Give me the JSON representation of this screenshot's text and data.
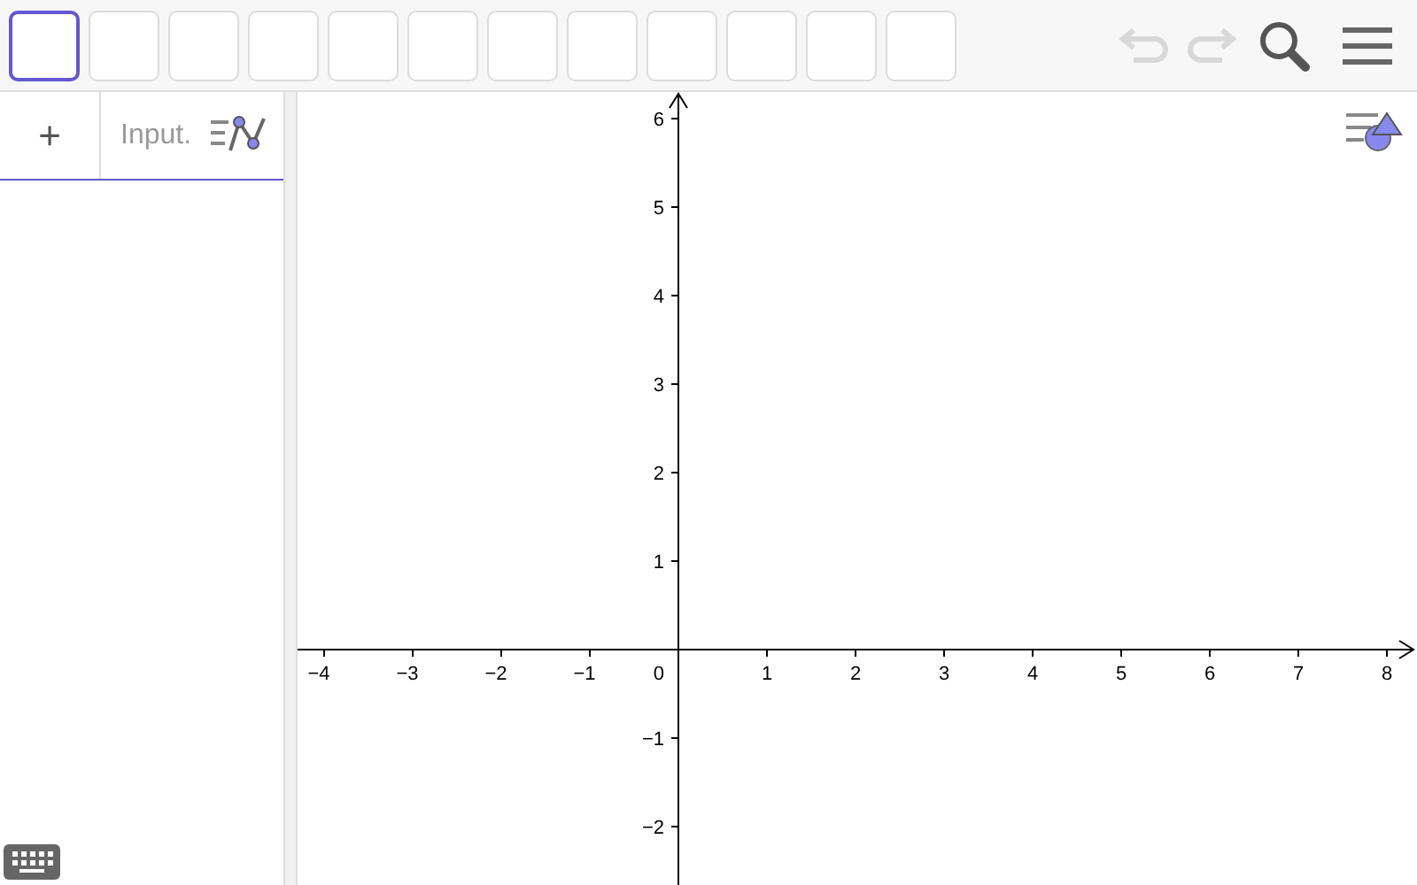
{
  "toolbar": {
    "tools": [
      {
        "selected": true
      },
      {
        "selected": false
      },
      {
        "selected": false
      },
      {
        "selected": false
      },
      {
        "selected": false
      },
      {
        "selected": false
      },
      {
        "selected": false
      },
      {
        "selected": false
      },
      {
        "selected": false
      },
      {
        "selected": false
      },
      {
        "selected": false
      },
      {
        "selected": false
      }
    ],
    "undo_disabled": true,
    "redo_disabled": true
  },
  "algebra": {
    "add_symbol": "+",
    "input_placeholder": "Input."
  },
  "graph": {
    "origin_label": "0",
    "x_negative_labels": [
      "−4",
      "−3",
      "−2",
      "−1"
    ],
    "x_positive_labels": [
      "1",
      "2",
      "3",
      "4",
      "5",
      "6",
      "7",
      "8"
    ],
    "y_positive_labels": [
      "6",
      "5",
      "4",
      "3",
      "2",
      "1"
    ],
    "y_negative_labels": [
      "−1",
      "−2"
    ]
  }
}
